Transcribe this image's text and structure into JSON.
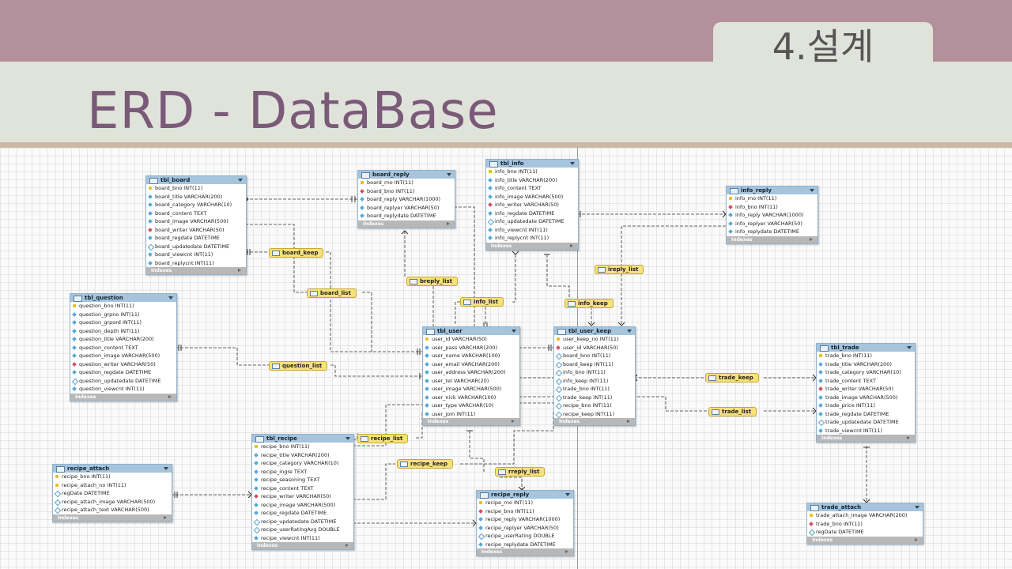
{
  "header": {
    "section": "4.설계",
    "title": "ERD - DataBase"
  },
  "footer_label": "Indexes",
  "tables": [
    {
      "id": "tbl_board",
      "title": "tbl_board",
      "columns": [
        {
          "text": "board_bno INT(11)",
          "kind": "key"
        },
        {
          "text": "board_title VARCHAR(200)",
          "kind": "col"
        },
        {
          "text": "board_category VARCHAR(10)",
          "kind": "col"
        },
        {
          "text": "board_content TEXT",
          "kind": "col"
        },
        {
          "text": "board_image VARCHAR(500)",
          "kind": "col"
        },
        {
          "text": "board_writer VARCHAR(50)",
          "kind": "fk"
        },
        {
          "text": "board_regdate DATETIME",
          "kind": "col"
        },
        {
          "text": "board_updatedate DATETIME",
          "kind": "nul"
        },
        {
          "text": "board_viewcnt INT(11)",
          "kind": "col"
        },
        {
          "text": "board_replycnt INT(11)",
          "kind": "col"
        }
      ]
    },
    {
      "id": "board_reply",
      "title": "board_reply",
      "columns": [
        {
          "text": "board_rno INT(11)",
          "kind": "key"
        },
        {
          "text": "board_bno INT(11)",
          "kind": "fk"
        },
        {
          "text": "board_reply VARCHAR(1000)",
          "kind": "col"
        },
        {
          "text": "board_replyer VARCHAR(50)",
          "kind": "col"
        },
        {
          "text": "board_replydate DATETIME",
          "kind": "col"
        }
      ]
    },
    {
      "id": "tbl_info",
      "title": "tbl_info",
      "columns": [
        {
          "text": "info_bno INT(11)",
          "kind": "key"
        },
        {
          "text": "info_title VARCHAR(200)",
          "kind": "col"
        },
        {
          "text": "info_content TEXT",
          "kind": "col"
        },
        {
          "text": "info_image VARCHAR(500)",
          "kind": "col"
        },
        {
          "text": "info_writer VARCHAR(50)",
          "kind": "fk"
        },
        {
          "text": "info_regdate DATETIME",
          "kind": "col"
        },
        {
          "text": "info_updatedate DATETIME",
          "kind": "nul"
        },
        {
          "text": "info_viewcnt INT(11)",
          "kind": "col"
        },
        {
          "text": "info_replycnt INT(11)",
          "kind": "col"
        }
      ]
    },
    {
      "id": "info_reply",
      "title": "info_reply",
      "columns": [
        {
          "text": "info_rno INT(11)",
          "kind": "key"
        },
        {
          "text": "info_bno INT(11)",
          "kind": "fk"
        },
        {
          "text": "info_reply VARCHAR(1000)",
          "kind": "col"
        },
        {
          "text": "info_replyer VARCHAR(50)",
          "kind": "col"
        },
        {
          "text": "info_replydate DATETIME",
          "kind": "col"
        }
      ]
    },
    {
      "id": "tbl_question",
      "title": "tbl_question",
      "columns": [
        {
          "text": "question_bno INT(11)",
          "kind": "key"
        },
        {
          "text": "question_grpno INT(11)",
          "kind": "col"
        },
        {
          "text": "question_grpord INT(11)",
          "kind": "col"
        },
        {
          "text": "question_depth INT(11)",
          "kind": "col"
        },
        {
          "text": "question_title VARCHAR(200)",
          "kind": "col"
        },
        {
          "text": "question_content TEXT",
          "kind": "col"
        },
        {
          "text": "question_image VARCHAR(500)",
          "kind": "col"
        },
        {
          "text": "question_writer VARCHAR(50)",
          "kind": "fk"
        },
        {
          "text": "question_regdate DATETIME",
          "kind": "col"
        },
        {
          "text": "question_updatedate DATETIME",
          "kind": "nul"
        },
        {
          "text": "question_viewcnt INT(11)",
          "kind": "col"
        }
      ]
    },
    {
      "id": "tbl_user",
      "title": "tbl_user",
      "columns": [
        {
          "text": "user_id VARCHAR(50)",
          "kind": "key"
        },
        {
          "text": "user_pass VARCHAR(200)",
          "kind": "col"
        },
        {
          "text": "user_name VARCHAR(100)",
          "kind": "col"
        },
        {
          "text": "user_email VARCHAR(200)",
          "kind": "col"
        },
        {
          "text": "user_address VARCHAR(200)",
          "kind": "col"
        },
        {
          "text": "user_tel VARCHAR(20)",
          "kind": "col"
        },
        {
          "text": "user_image VARCHAR(500)",
          "kind": "col"
        },
        {
          "text": "user_nick VARCHAR(100)",
          "kind": "col"
        },
        {
          "text": "user_type VARCHAR(10)",
          "kind": "col"
        },
        {
          "text": "user_join INT(11)",
          "kind": "col"
        }
      ]
    },
    {
      "id": "tbl_user_keep",
      "title": "tbl_user_keep",
      "columns": [
        {
          "text": "user_keep_no INT(11)",
          "kind": "key"
        },
        {
          "text": "user_id VARCHAR(50)",
          "kind": "fk"
        },
        {
          "text": "board_bno INT(11)",
          "kind": "nul"
        },
        {
          "text": "board_keep INT(11)",
          "kind": "nul"
        },
        {
          "text": "info_bno INT(11)",
          "kind": "nul"
        },
        {
          "text": "info_keep INT(11)",
          "kind": "nul"
        },
        {
          "text": "trade_bno INT(11)",
          "kind": "nul"
        },
        {
          "text": "trade_keep INT(11)",
          "kind": "nul"
        },
        {
          "text": "recipe_bno INT(11)",
          "kind": "nul"
        },
        {
          "text": "recipe_keep INT(11)",
          "kind": "nul"
        }
      ]
    },
    {
      "id": "tbl_trade",
      "title": "tbl_trade",
      "columns": [
        {
          "text": "trade_bno INT(11)",
          "kind": "key"
        },
        {
          "text": "trade_title VARCHAR(200)",
          "kind": "col"
        },
        {
          "text": "trade_category VARCHAR(10)",
          "kind": "col"
        },
        {
          "text": "trade_content TEXT",
          "kind": "col"
        },
        {
          "text": "trade_writer VARCHAR(50)",
          "kind": "fk"
        },
        {
          "text": "trade_image VARCHAR(500)",
          "kind": "col"
        },
        {
          "text": "trade_price INT(11)",
          "kind": "col"
        },
        {
          "text": "trade_regdate DATETIME",
          "kind": "col"
        },
        {
          "text": "trade_updatedate DATETIME",
          "kind": "nul"
        },
        {
          "text": "trade_viewcnt INT(11)",
          "kind": "col"
        }
      ]
    },
    {
      "id": "tbl_recipe",
      "title": "tbl_recipe",
      "columns": [
        {
          "text": "recipe_bno INT(11)",
          "kind": "key"
        },
        {
          "text": "recipe_title VARCHAR(200)",
          "kind": "col"
        },
        {
          "text": "recipe_category VARCHAR(10)",
          "kind": "col"
        },
        {
          "text": "recipe_ingre TEXT",
          "kind": "col"
        },
        {
          "text": "recipe_seasoning TEXT",
          "kind": "col"
        },
        {
          "text": "recipe_content TEXT",
          "kind": "col"
        },
        {
          "text": "recipe_writer VARCHAR(50)",
          "kind": "fk"
        },
        {
          "text": "recipe_image VARCHAR(500)",
          "kind": "col"
        },
        {
          "text": "recipe_regdate DATETIME",
          "kind": "col"
        },
        {
          "text": "recipe_updatedate DATETIME",
          "kind": "nul"
        },
        {
          "text": "recipe_userRatingAvg DOUBLE",
          "kind": "nul"
        },
        {
          "text": "recipe_viewcnt INT(11)",
          "kind": "col"
        }
      ]
    },
    {
      "id": "recipe_attach",
      "title": "recipe_attach",
      "columns": [
        {
          "text": "recipe_bno INT(11)",
          "kind": "key"
        },
        {
          "text": "recipe_attach_no INT(11)",
          "kind": "key"
        },
        {
          "text": "regDate DATETIME",
          "kind": "nul"
        },
        {
          "text": "recipe_attach_image VARCHAR(500)",
          "kind": "nul"
        },
        {
          "text": "recipe_attach_text VARCHAR(500)",
          "kind": "nul"
        }
      ]
    },
    {
      "id": "recipe_reply",
      "title": "recipe_reply",
      "columns": [
        {
          "text": "recipe_rno INT(11)",
          "kind": "key"
        },
        {
          "text": "recipe_bno INT(11)",
          "kind": "fk"
        },
        {
          "text": "recipe_reply VARCHAR(1000)",
          "kind": "col"
        },
        {
          "text": "recipe_replyer VARCHAR(50)",
          "kind": "col"
        },
        {
          "text": "recipe_userRating DOUBLE",
          "kind": "nul"
        },
        {
          "text": "recipe_replydate DATETIME",
          "kind": "col"
        }
      ]
    },
    {
      "id": "trade_attach",
      "title": "trade_attach",
      "columns": [
        {
          "text": "trade_attach_image VARCHAR(200)",
          "kind": "key"
        },
        {
          "text": "trade_bno INT(11)",
          "kind": "fk"
        },
        {
          "text": "regDate DATETIME",
          "kind": "nul"
        }
      ]
    }
  ],
  "relations": [
    "board_keep",
    "breply_list",
    "board_list",
    "info_list",
    "info_keep",
    "ireply_list",
    "question_list",
    "trade_keep",
    "trade_list",
    "recipe_list",
    "recipe_keep",
    "rreply_list"
  ]
}
